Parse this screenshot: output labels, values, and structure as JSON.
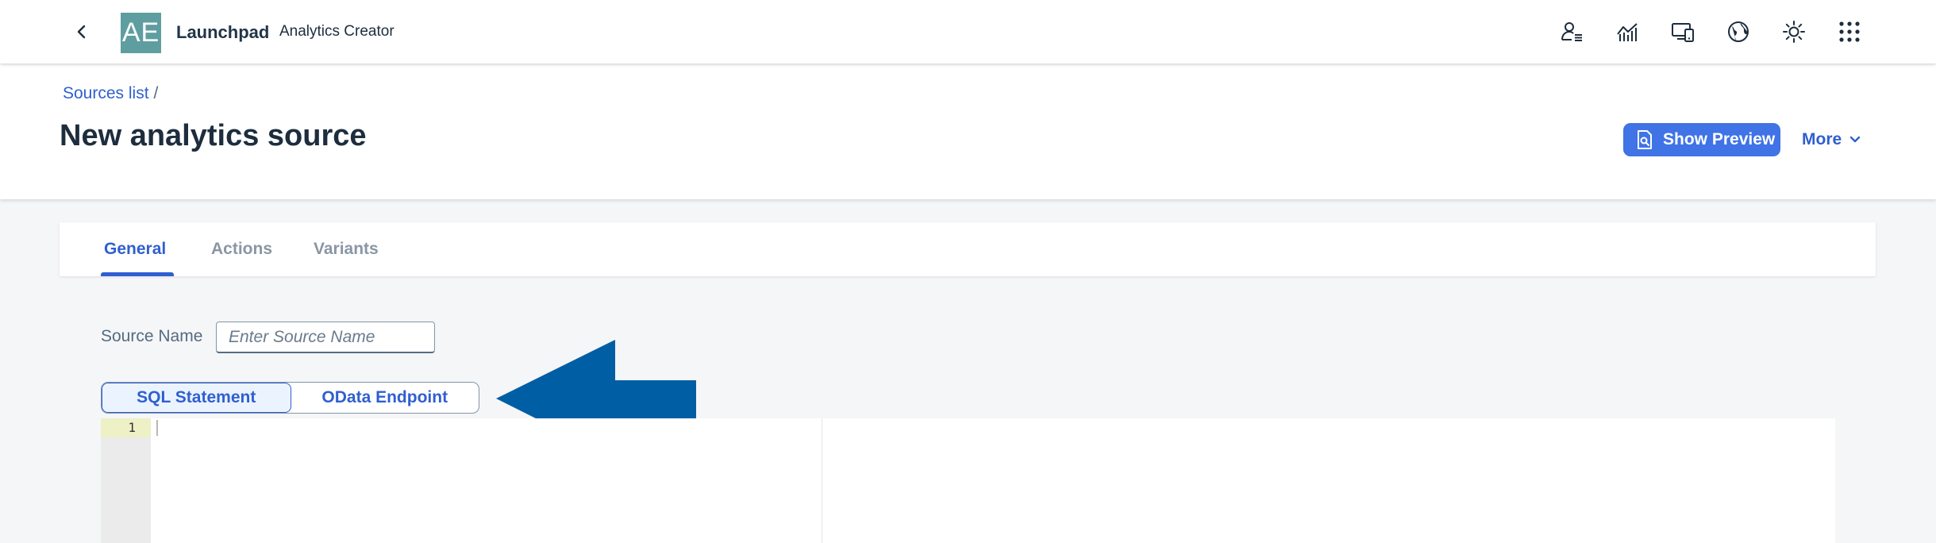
{
  "shell": {
    "logo_text": "AE",
    "title": "Launchpad",
    "subtitle": "Analytics Creator",
    "action_icons": [
      "user-settings-icon",
      "line-chart-icon",
      "devices-icon",
      "globe-icon",
      "sun-icon",
      "app-grid-icon"
    ]
  },
  "header": {
    "breadcrumb": {
      "link": "Sources list",
      "separator": "/"
    },
    "title": "New analytics source",
    "show_preview_label": "Show Preview",
    "more_label": "More"
  },
  "tabs": [
    {
      "label": "General",
      "active": true
    },
    {
      "label": "Actions",
      "active": false
    },
    {
      "label": "Variants",
      "active": false
    }
  ],
  "form": {
    "source_name_label": "Source Name",
    "source_name_value": "",
    "source_name_placeholder": "Enter Source Name"
  },
  "segmented": {
    "options": [
      {
        "label": "SQL Statement",
        "selected": true
      },
      {
        "label": "OData Endpoint",
        "selected": false
      }
    ]
  },
  "editor": {
    "line_numbers": [
      "1"
    ]
  },
  "colors": {
    "brand": "#2f5fd0",
    "logo_bg": "#5f9ea0",
    "button_bg": "#3f73e6",
    "arrow": "#005ea5"
  }
}
